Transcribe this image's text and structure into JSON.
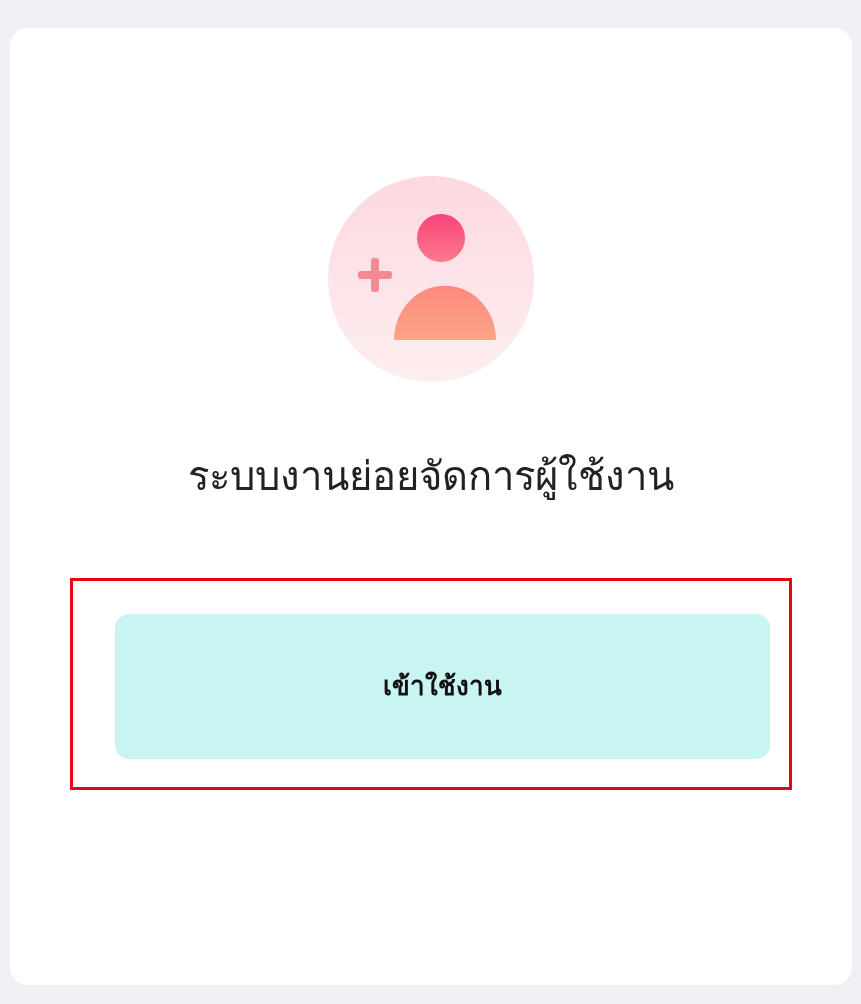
{
  "card": {
    "title": "ระบบงานย่อยจัดการผู้ใช้งาน",
    "button": {
      "label": "เข้าใช้งาน",
      "highlighted": true
    }
  }
}
